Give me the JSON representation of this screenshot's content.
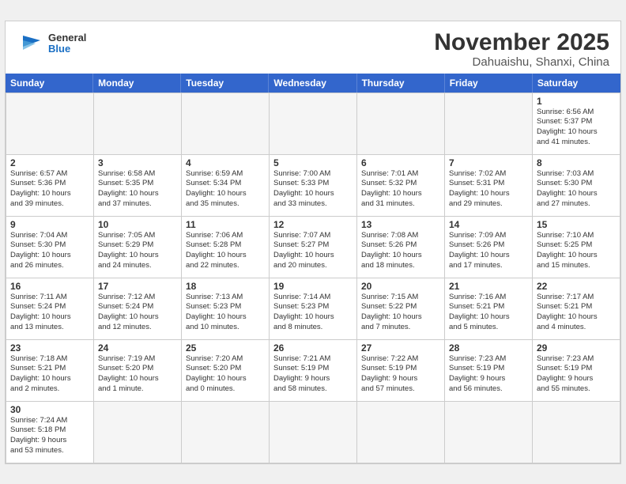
{
  "header": {
    "logo_general": "General",
    "logo_blue": "Blue",
    "month": "November 2025",
    "location": "Dahuaishu, Shanxi, China"
  },
  "day_headers": [
    "Sunday",
    "Monday",
    "Tuesday",
    "Wednesday",
    "Thursday",
    "Friday",
    "Saturday"
  ],
  "cells": [
    {
      "day": "",
      "text": "",
      "empty": true
    },
    {
      "day": "",
      "text": "",
      "empty": true
    },
    {
      "day": "",
      "text": "",
      "empty": true
    },
    {
      "day": "",
      "text": "",
      "empty": true
    },
    {
      "day": "",
      "text": "",
      "empty": true
    },
    {
      "day": "",
      "text": "",
      "empty": true
    },
    {
      "day": "1",
      "text": "Sunrise: 6:56 AM\nSunset: 5:37 PM\nDaylight: 10 hours\nand 41 minutes."
    },
    {
      "day": "2",
      "text": "Sunrise: 6:57 AM\nSunset: 5:36 PM\nDaylight: 10 hours\nand 39 minutes."
    },
    {
      "day": "3",
      "text": "Sunrise: 6:58 AM\nSunset: 5:35 PM\nDaylight: 10 hours\nand 37 minutes."
    },
    {
      "day": "4",
      "text": "Sunrise: 6:59 AM\nSunset: 5:34 PM\nDaylight: 10 hours\nand 35 minutes."
    },
    {
      "day": "5",
      "text": "Sunrise: 7:00 AM\nSunset: 5:33 PM\nDaylight: 10 hours\nand 33 minutes."
    },
    {
      "day": "6",
      "text": "Sunrise: 7:01 AM\nSunset: 5:32 PM\nDaylight: 10 hours\nand 31 minutes."
    },
    {
      "day": "7",
      "text": "Sunrise: 7:02 AM\nSunset: 5:31 PM\nDaylight: 10 hours\nand 29 minutes."
    },
    {
      "day": "8",
      "text": "Sunrise: 7:03 AM\nSunset: 5:30 PM\nDaylight: 10 hours\nand 27 minutes."
    },
    {
      "day": "9",
      "text": "Sunrise: 7:04 AM\nSunset: 5:30 PM\nDaylight: 10 hours\nand 26 minutes."
    },
    {
      "day": "10",
      "text": "Sunrise: 7:05 AM\nSunset: 5:29 PM\nDaylight: 10 hours\nand 24 minutes."
    },
    {
      "day": "11",
      "text": "Sunrise: 7:06 AM\nSunset: 5:28 PM\nDaylight: 10 hours\nand 22 minutes."
    },
    {
      "day": "12",
      "text": "Sunrise: 7:07 AM\nSunset: 5:27 PM\nDaylight: 10 hours\nand 20 minutes."
    },
    {
      "day": "13",
      "text": "Sunrise: 7:08 AM\nSunset: 5:26 PM\nDaylight: 10 hours\nand 18 minutes."
    },
    {
      "day": "14",
      "text": "Sunrise: 7:09 AM\nSunset: 5:26 PM\nDaylight: 10 hours\nand 17 minutes."
    },
    {
      "day": "15",
      "text": "Sunrise: 7:10 AM\nSunset: 5:25 PM\nDaylight: 10 hours\nand 15 minutes."
    },
    {
      "day": "16",
      "text": "Sunrise: 7:11 AM\nSunset: 5:24 PM\nDaylight: 10 hours\nand 13 minutes."
    },
    {
      "day": "17",
      "text": "Sunrise: 7:12 AM\nSunset: 5:24 PM\nDaylight: 10 hours\nand 12 minutes."
    },
    {
      "day": "18",
      "text": "Sunrise: 7:13 AM\nSunset: 5:23 PM\nDaylight: 10 hours\nand 10 minutes."
    },
    {
      "day": "19",
      "text": "Sunrise: 7:14 AM\nSunset: 5:23 PM\nDaylight: 10 hours\nand 8 minutes."
    },
    {
      "day": "20",
      "text": "Sunrise: 7:15 AM\nSunset: 5:22 PM\nDaylight: 10 hours\nand 7 minutes."
    },
    {
      "day": "21",
      "text": "Sunrise: 7:16 AM\nSunset: 5:21 PM\nDaylight: 10 hours\nand 5 minutes."
    },
    {
      "day": "22",
      "text": "Sunrise: 7:17 AM\nSunset: 5:21 PM\nDaylight: 10 hours\nand 4 minutes."
    },
    {
      "day": "23",
      "text": "Sunrise: 7:18 AM\nSunset: 5:21 PM\nDaylight: 10 hours\nand 2 minutes."
    },
    {
      "day": "24",
      "text": "Sunrise: 7:19 AM\nSunset: 5:20 PM\nDaylight: 10 hours\nand 1 minute."
    },
    {
      "day": "25",
      "text": "Sunrise: 7:20 AM\nSunset: 5:20 PM\nDaylight: 10 hours\nand 0 minutes."
    },
    {
      "day": "26",
      "text": "Sunrise: 7:21 AM\nSunset: 5:19 PM\nDaylight: 9 hours\nand 58 minutes."
    },
    {
      "day": "27",
      "text": "Sunrise: 7:22 AM\nSunset: 5:19 PM\nDaylight: 9 hours\nand 57 minutes."
    },
    {
      "day": "28",
      "text": "Sunrise: 7:23 AM\nSunset: 5:19 PM\nDaylight: 9 hours\nand 56 minutes."
    },
    {
      "day": "29",
      "text": "Sunrise: 7:23 AM\nSunset: 5:19 PM\nDaylight: 9 hours\nand 55 minutes."
    },
    {
      "day": "30",
      "text": "Sunrise: 7:24 AM\nSunset: 5:18 PM\nDaylight: 9 hours\nand 53 minutes."
    },
    {
      "day": "",
      "text": "",
      "empty": true
    },
    {
      "day": "",
      "text": "",
      "empty": true
    },
    {
      "day": "",
      "text": "",
      "empty": true
    },
    {
      "day": "",
      "text": "",
      "empty": true
    },
    {
      "day": "",
      "text": "",
      "empty": true
    },
    {
      "day": "",
      "text": "",
      "empty": true
    }
  ]
}
